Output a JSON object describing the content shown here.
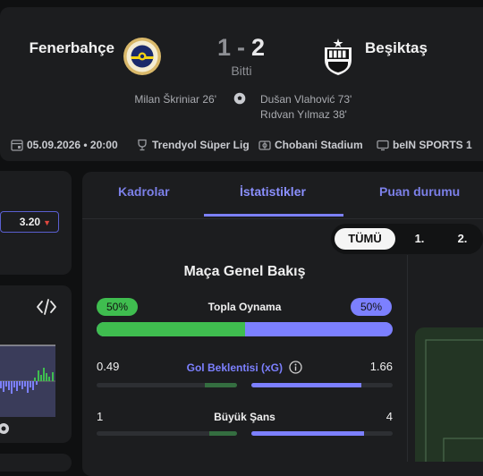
{
  "match": {
    "home_team": "Fenerbahçe",
    "away_team": "Beşiktaş",
    "home_score": "1",
    "away_score": "2",
    "score_sep": "-",
    "status": "Bitti",
    "home_scorers": [
      "Milan Škriniar 26'"
    ],
    "away_scorers": [
      "Dušan Vlahović 73'",
      "Rıdvan Yılmaz 38'"
    ]
  },
  "meta": {
    "date": "05.09.2026 • 20:00",
    "league": "Trendyol Süper Lig",
    "stadium": "Chobani Stadium",
    "broadcaster": "beIN SPORTS 1"
  },
  "left_panel": {
    "odds_value": "3.20",
    "odds_trend": "▼"
  },
  "tabs": [
    "Kadrolar",
    "İstatistikler",
    "Puan durumu"
  ],
  "active_tab": "İstatistikler",
  "period_filter": {
    "options": [
      "TÜMÜ",
      "1.",
      "2."
    ],
    "selected": "TÜMÜ"
  },
  "stats": {
    "title": "Maça Genel Bakış",
    "possession": {
      "label": "Topla Oynama",
      "home": "50%",
      "away": "50%",
      "home_share": 0.5
    },
    "rows": [
      {
        "label": "Gol Beklentisi (xG)",
        "home": "0.49",
        "away": "1.66",
        "home_share": 0.23,
        "away_share": 0.78,
        "has_info": true
      },
      {
        "label": "Büyük Şans",
        "home": "1",
        "away": "4",
        "home_share": 0.2,
        "away_share": 0.8,
        "has_info": false
      }
    ]
  },
  "colors": {
    "home": "#3fbd4f",
    "away": "#7c80ff",
    "accent": "#7c80ff",
    "card": "#1c1d1f",
    "background": "#0f1011"
  },
  "icons": [
    "fenerbahce-crest",
    "besiktas-crest",
    "football-icon",
    "calendar-icon",
    "trophy-icon",
    "stadium-icon",
    "tv-icon",
    "code-embed-icon",
    "info-icon"
  ]
}
